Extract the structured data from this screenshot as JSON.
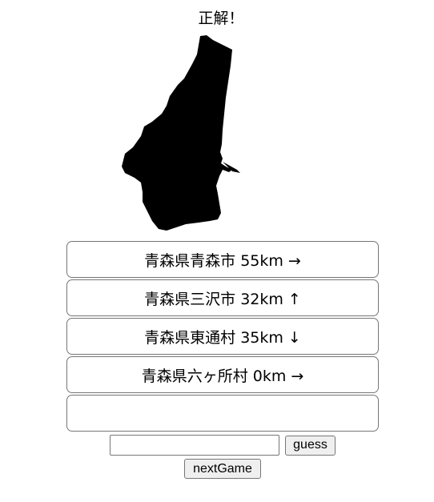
{
  "result_text": "正解！",
  "map": {
    "fill_color": "#000000",
    "icon": "municipality-silhouette"
  },
  "guesses": [
    {
      "text": "青森県青森市 55km →"
    },
    {
      "text": "青森県三沢市 32km ↑"
    },
    {
      "text": "青森県東通村 35km ↓"
    },
    {
      "text": "青森県六ヶ所村 0km →"
    },
    {
      "text": ""
    }
  ],
  "input": {
    "value": "",
    "placeholder": ""
  },
  "buttons": {
    "guess_label": "guess",
    "next_label": "nextGame"
  }
}
